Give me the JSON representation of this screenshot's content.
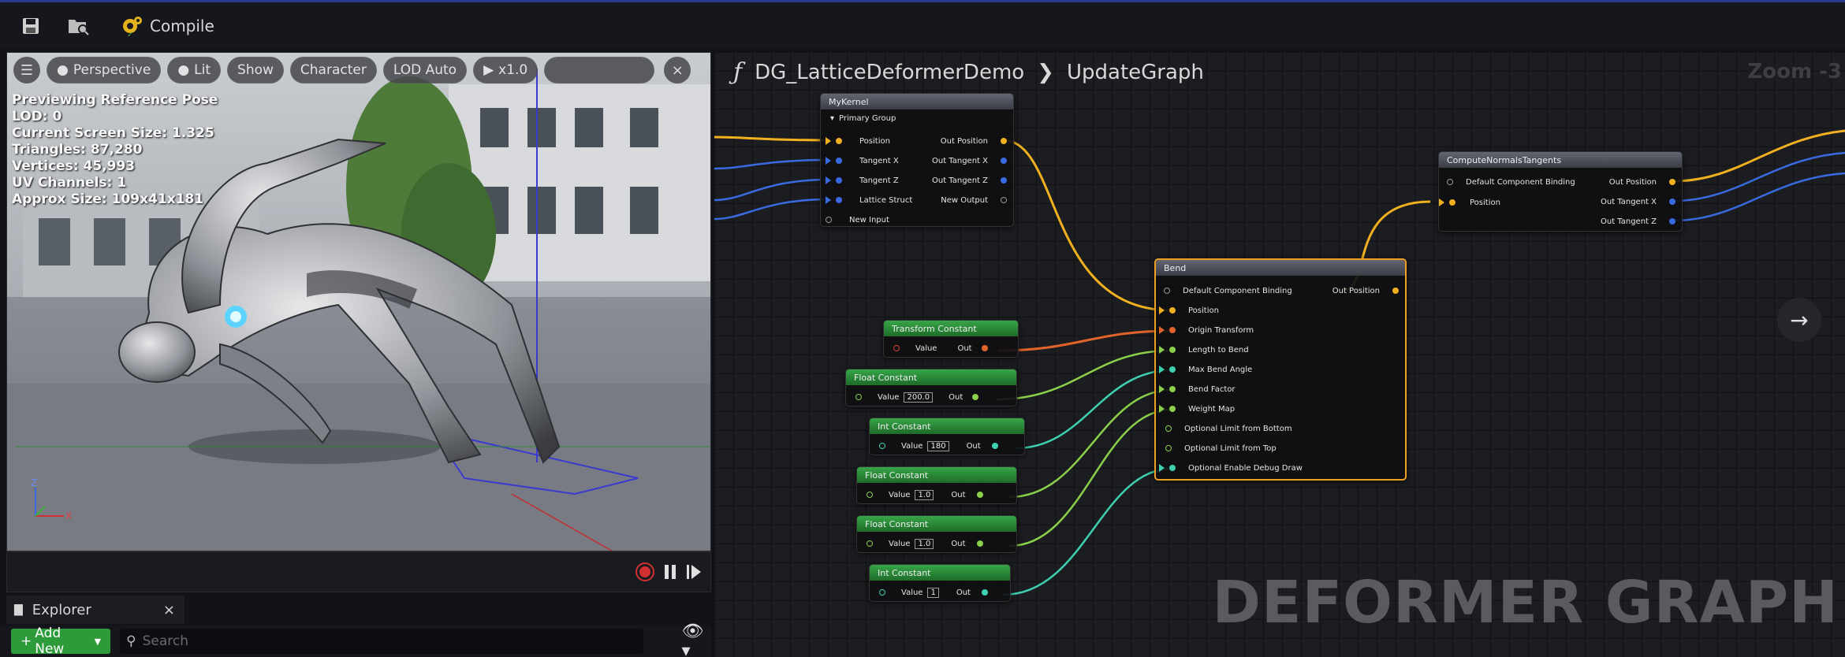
{
  "toolbar": {
    "compile_label": "Compile",
    "icons": [
      "save-icon",
      "browse-icon",
      "compile-icon"
    ]
  },
  "viewport": {
    "controls": {
      "perspective": "Perspective",
      "lit": "Lit",
      "show": "Show",
      "character": "Character",
      "lod": "LOD Auto",
      "speed": "x1.0"
    },
    "info": [
      "Previewing Reference Pose",
      "LOD: 0",
      "Current Screen Size: 1.325",
      "Triangles: 87,280",
      "Vertices: 45,993",
      "UV Channels: 1",
      "Approx Size: 109x41x181"
    ],
    "axis": {
      "z": "Z",
      "x": "X"
    }
  },
  "explorer": {
    "tab_label": "Explorer",
    "add_new": "Add New",
    "search_placeholder": "Search"
  },
  "graph": {
    "breadcrumb_root": "DG_LatticeDeformerDemo",
    "breadcrumb_child": "UpdateGraph",
    "zoom": "Zoom -3",
    "watermark": "DEFORMER GRAPH",
    "nodes": {
      "mykernel": {
        "title": "MyKernel",
        "group": "Primary Group",
        "inputs": [
          "Position",
          "Tangent X",
          "Tangent Z",
          "Lattice Struct",
          "New Input"
        ],
        "outputs": [
          "Out Position",
          "Out Tangent X",
          "Out Tangent Z",
          "New Output"
        ]
      },
      "compute": {
        "title": "ComputeNormalsTangents",
        "inputs": [
          "Default Component Binding",
          "Position"
        ],
        "outputs": [
          "Out Position",
          "Out Tangent X",
          "Out Tangent Z"
        ]
      },
      "bend": {
        "title": "Bend",
        "inputs": [
          "Default Component Binding",
          "Position",
          "Origin Transform",
          "Length to Bend",
          "Max Bend Angle",
          "Bend Factor",
          "Weight Map",
          "Optional Limit from Bottom",
          "Optional Limit from Top",
          "Optional Enable Debug Draw"
        ],
        "outputs": [
          "Out Position"
        ]
      },
      "constants": [
        {
          "title": "Transform Constant",
          "label": "Value",
          "value": "",
          "out": "Out"
        },
        {
          "title": "Float Constant",
          "label": "Value",
          "value": "200.0",
          "out": "Out"
        },
        {
          "title": "Int Constant",
          "label": "Value",
          "value": "180",
          "out": "Out"
        },
        {
          "title": "Float Constant",
          "label": "Value",
          "value": "1.0",
          "out": "Out"
        },
        {
          "title": "Float Constant",
          "label": "Value",
          "value": "1.0",
          "out": "Out"
        },
        {
          "title": "Int Constant",
          "label": "Value",
          "value": "1",
          "out": "Out"
        }
      ]
    }
  },
  "colors": {
    "accent_green": "#2e9b3a",
    "wire_position": "#f0b020",
    "wire_transform": "#e0642a",
    "wire_float": "#8ad04a",
    "wire_int": "#3ed0b0",
    "wire_vector": "#3a6ae0",
    "selection": "#f0a020"
  }
}
